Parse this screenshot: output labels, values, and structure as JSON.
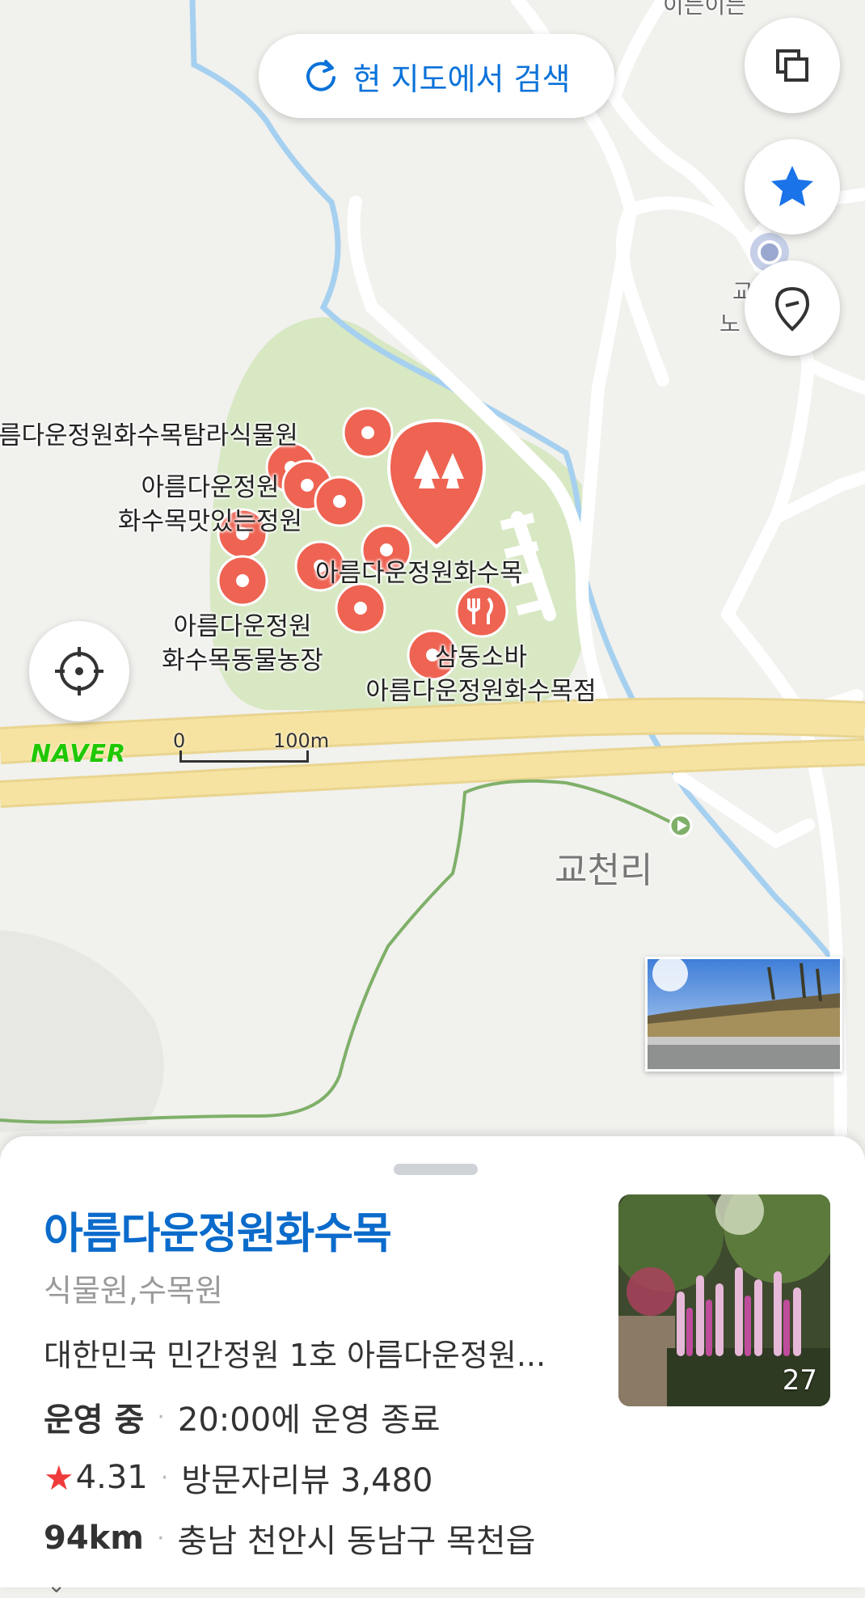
{
  "search_here_label": "현 지도에서 검색",
  "map": {
    "brand": "NAVER",
    "scale": {
      "start": "0",
      "end": "100m"
    },
    "village_label": "교천리",
    "partial_labels": {
      "top": "이든이든",
      "right1": "교",
      "right2": "노"
    },
    "poi_labels": [
      {
        "lines": [
          "름다운정원화수목탐라식물원"
        ]
      },
      {
        "lines": [
          "아름다운정원",
          "화수목맛있는정원"
        ]
      },
      {
        "lines": [
          "아름다운정원화수목"
        ]
      },
      {
        "lines": [
          "아름다운정원",
          "화수목동물농장"
        ]
      },
      {
        "lines": [
          "삼동소바",
          "아름다운정원화수목점"
        ]
      }
    ]
  },
  "buttons": {
    "layers": "layers-icon",
    "favorites": "star-icon",
    "places": "location-pin-icon",
    "my_location": "crosshair-icon"
  },
  "colors": {
    "accent": "#0B6BCB",
    "marker": "#EE6352",
    "park": "#D7E8C3",
    "road_major": "#F7E3A1",
    "water": "#A6D0EF",
    "trail": "#7FB069"
  },
  "place": {
    "name": "아름다운정원화수목",
    "category": "식물원,수목원",
    "description": "대한민국 민간정원 1호 아름다운정원...",
    "status": "운영 중",
    "hours": "20:00에 운영 종료",
    "rating": "4.31",
    "reviews": "방문자리뷰 3,480",
    "distance": "94km",
    "address": "충남 천안시 동남구 목천읍",
    "photo_count": "27"
  }
}
